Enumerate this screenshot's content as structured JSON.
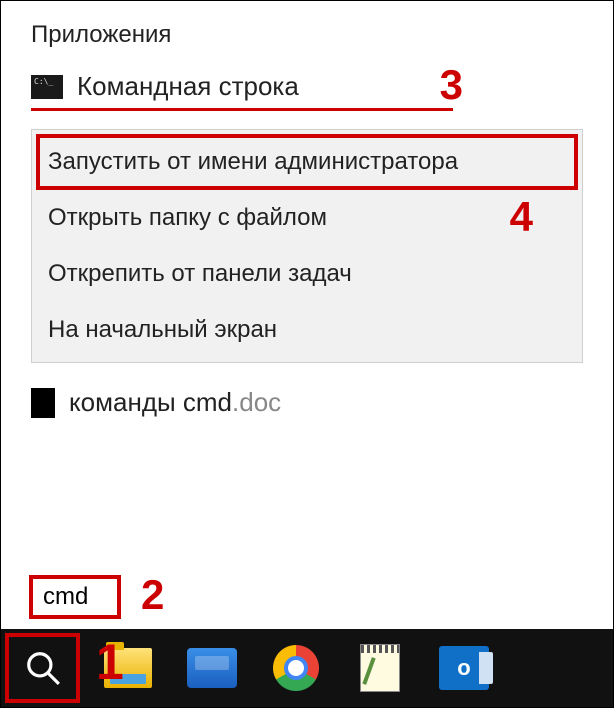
{
  "section_header": "Приложения",
  "app": {
    "label": "Командная строка"
  },
  "menu": {
    "items": [
      "Запустить от имени администратора",
      "Открыть папку с файлом",
      "Открепить от панели задач",
      "На начальный экран"
    ]
  },
  "doc": {
    "name": "команды cmd",
    "ext": ".doc"
  },
  "search": {
    "value": "cmd"
  },
  "taskbar": {
    "outlook_glyph": "o"
  },
  "annotations": {
    "n1": "1",
    "n2": "2",
    "n3": "3",
    "n4": "4"
  }
}
